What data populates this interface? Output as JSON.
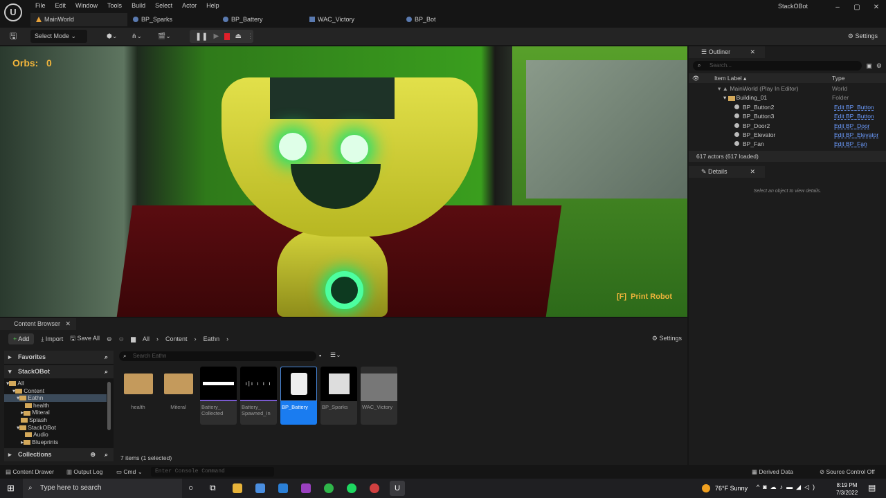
{
  "menu": [
    "File",
    "Edit",
    "Window",
    "Tools",
    "Build",
    "Select",
    "Actor",
    "Help"
  ],
  "tabs": [
    "MainWorld",
    "BP_Sparks",
    "BP_Battery",
    "WAC_Victory",
    "BP_Bot"
  ],
  "project": "StackOBot",
  "window_controls": [
    "–",
    "▢",
    "✕"
  ],
  "toolbar": {
    "select_mode": "Select Mode",
    "settings": "Settings"
  },
  "viewport": {
    "orbs_label": "Orbs:",
    "orbs_value": "0",
    "prompt_key": "[F]",
    "prompt_text": "Print Robot"
  },
  "outliner": {
    "title": "Outliner",
    "search_placeholder": "Search...",
    "col_label": "Item Label ▴",
    "col_type": "Type",
    "rows": [
      {
        "label": "MainWorld (Play In Editor)",
        "type": "World"
      },
      {
        "label": "Building_01",
        "type": "Folder"
      },
      {
        "label": "BP_Button2",
        "type": "Edit BP_Button"
      },
      {
        "label": "BP_Button3",
        "type": "Edit BP_Button"
      },
      {
        "label": "BP_Door2",
        "type": "Edit BP_Door"
      },
      {
        "label": "BP_Elevator",
        "type": "Edit BP_Elevator"
      },
      {
        "label": "BP_Fan",
        "type": "Edit BP_Fan"
      }
    ],
    "status": "617 actors (617 loaded)"
  },
  "details": {
    "title": "Details",
    "empty": "Select an object to view details."
  },
  "content_browser": {
    "title": "Content Browser",
    "add": "Add",
    "import": "Import",
    "save_all": "Save All",
    "breadcrumb": [
      "All",
      "Content",
      "Eathn"
    ],
    "settings": "Settings",
    "favorites": "Favorites",
    "project": "StackOBot",
    "collections": "Collections",
    "search_placeholder": "Search Eathn",
    "tree": [
      "All",
      "Content",
      "Eathn",
      "health",
      "Miteral",
      "Splash",
      "StackOBot",
      "Audio",
      "Blueprints"
    ],
    "items": [
      "health",
      "Miteral",
      "Battery_\nCollected",
      "Battery_\nSpawned_In",
      "BP_Battery",
      "BP_Sparks",
      "WAC_Victory"
    ],
    "count": "7 items (1 selected)"
  },
  "statusbar": {
    "content_drawer": "Content Drawer",
    "output_log": "Output Log",
    "cmd": "Cmd",
    "console_placeholder": "Enter Console Command",
    "derived": "Derived Data",
    "source": "Source Control Off"
  },
  "taskbar": {
    "search": "Type here to search",
    "weather": "76°F  Sunny",
    "time": "8:19 PM",
    "date": "7/3/2022"
  }
}
